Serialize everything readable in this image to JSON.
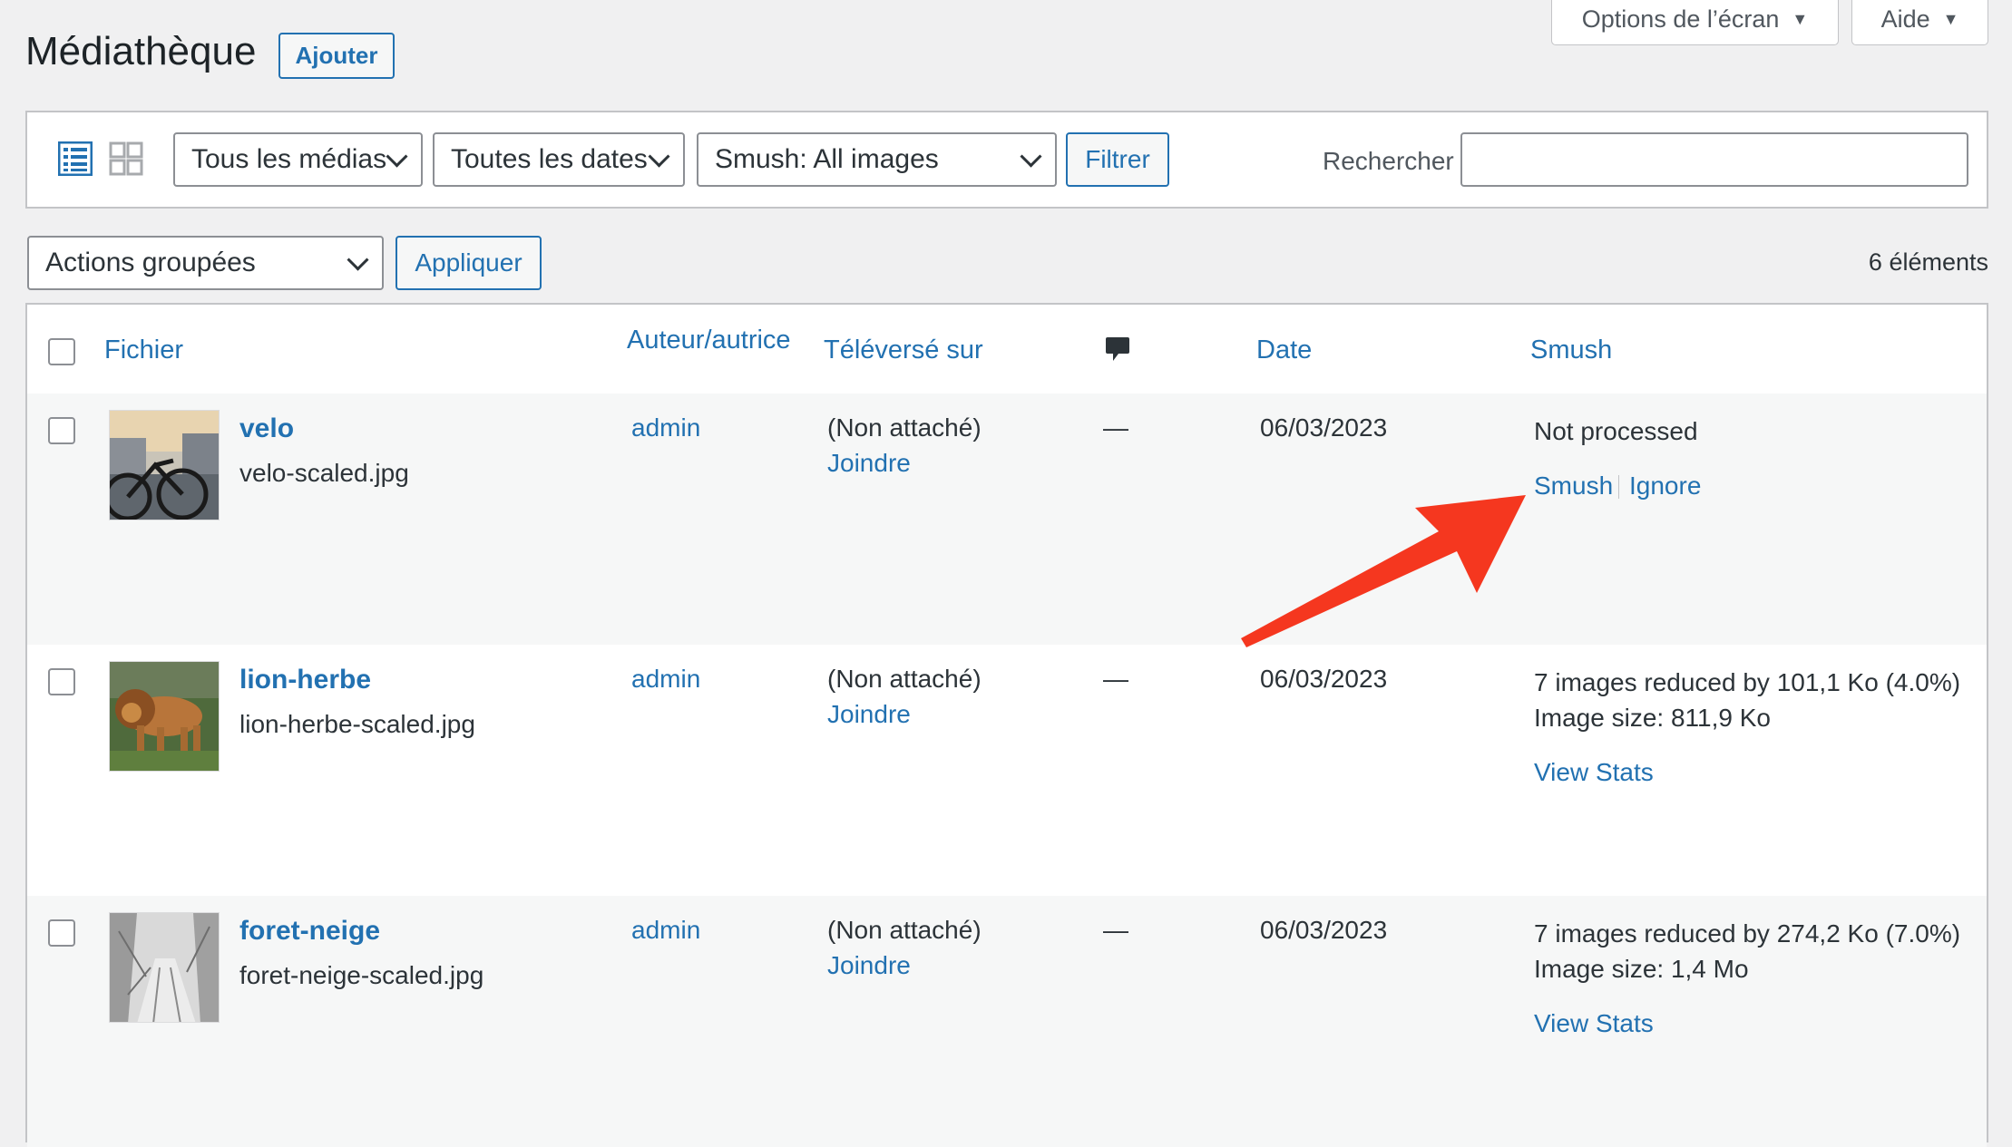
{
  "header": {
    "screen_options": "Options de l’écran",
    "help": "Aide",
    "title": "Médiathèque",
    "add_button": "Ajouter"
  },
  "filters": {
    "media_type": "Tous les médias",
    "dates": "Toutes les dates",
    "smush": "Smush: All images",
    "filter_button": "Filtrer",
    "search_label": "Rechercher",
    "search_value": ""
  },
  "bulk": {
    "actions": "Actions groupées",
    "apply": "Appliquer",
    "count": "6 éléments"
  },
  "columns": {
    "file": "Fichier",
    "author": "Auteur/autrice",
    "uploaded_to": "Téléversé sur",
    "comments_icon": "comment-bubble-icon",
    "date": "Date",
    "smush": "Smush"
  },
  "rows": [
    {
      "title": "velo",
      "filename": "velo-scaled.jpg",
      "author": "admin",
      "uploaded": "(Non attaché)",
      "attach": "Joindre",
      "comments": "—",
      "date": "06/03/2023",
      "smush_status": "Not processed",
      "smush_action": "Smush",
      "ignore_action": "Ignore"
    },
    {
      "title": "lion-herbe",
      "filename": "lion-herbe-scaled.jpg",
      "author": "admin",
      "uploaded": "(Non attaché)",
      "attach": "Joindre",
      "comments": "—",
      "date": "06/03/2023",
      "smush_reduced": "7 images reduced by 101,1 Ko (4.0%)",
      "smush_size": "Image size: 811,9 Ko",
      "view_stats": "View Stats"
    },
    {
      "title": "foret-neige",
      "filename": "foret-neige-scaled.jpg",
      "author": "admin",
      "uploaded": "(Non attaché)",
      "attach": "Joindre",
      "comments": "—",
      "date": "06/03/2023",
      "smush_reduced": "7 images reduced by 274,2 Ko (7.0%)",
      "smush_size": "Image size: 1,4 Mo",
      "view_stats": "View Stats"
    }
  ],
  "colors": {
    "link": "#2271b1",
    "arrow": "#f5371f",
    "background": "#f0f0f1"
  }
}
